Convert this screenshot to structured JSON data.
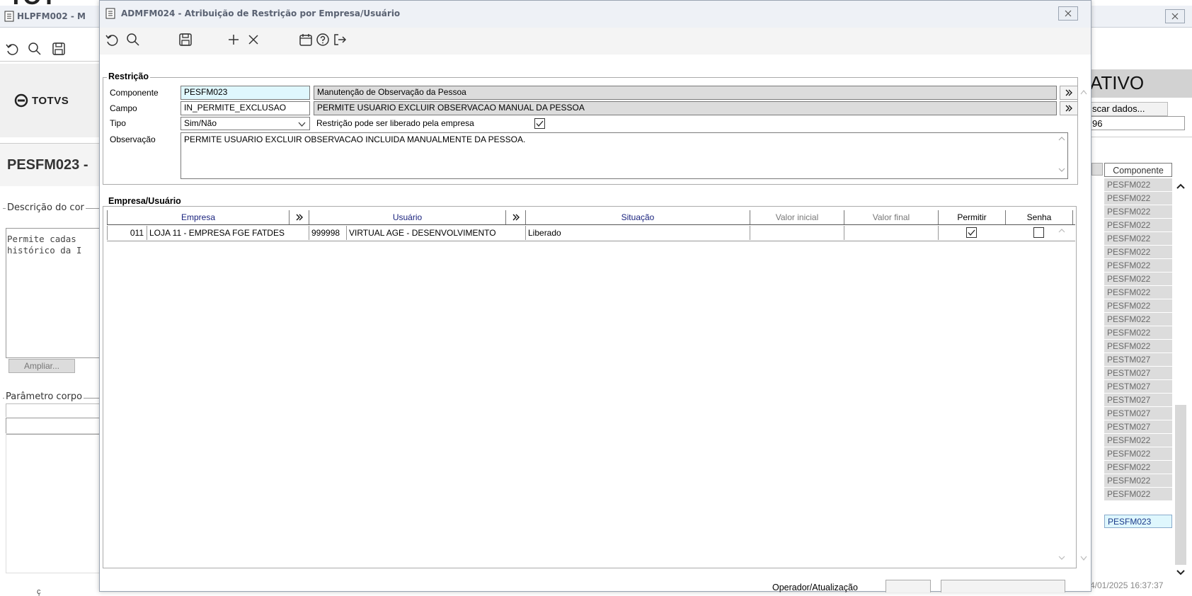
{
  "background_window": {
    "title": "HLPFM002 - M",
    "logo_partial": "TOT",
    "totvs_logo": "TOTVS",
    "heading": "PESFM023 -",
    "description_legend": "Descrição do cor",
    "description_text_line1": "Permite cadas",
    "description_text_line2": "histórico da I",
    "ampliar_button": "Ampliar...",
    "parametro_legend": "Parâmetro corpo",
    "status_label": "ATIVO",
    "buscar_button": "scar dados...",
    "code_value": "96",
    "grid_header": "Componente",
    "grid_rows": [
      "PESFM022",
      "PESFM022",
      "PESFM022",
      "PESFM022",
      "PESFM022",
      "PESFM022",
      "PESFM022",
      "PESFM022",
      "PESFM022",
      "PESFM022",
      "PESFM022",
      "PESFM022",
      "PESFM022",
      "PESTM027",
      "PESTM027",
      "PESTM027",
      "PESTM027",
      "PESTM027",
      "PESTM027",
      "PESFM022",
      "PESFM022",
      "PESFM022",
      "PESFM022",
      "PESFM022"
    ],
    "grid_selected": "PESFM023",
    "timestamp": "4/01/2025 16:37:37"
  },
  "dialog": {
    "title": "ADMFM024 - Atribuição de Restrição por Empresa/Usuário",
    "restricao": {
      "legend": "Restrição",
      "componente_label": "Componente",
      "componente_value": "PESFM023",
      "componente_desc": "Manutenção de Observação da Pessoa",
      "campo_label": "Campo",
      "campo_value": "IN_PERMITE_EXCLUSAO",
      "campo_desc": "PERMITE USUARIO EXCLUIR OBSERVACAO MANUAL DA PESSOA",
      "tipo_label": "Tipo",
      "tipo_value": "Sim/Não",
      "liberado_label": "Restrição pode ser liberado pela empresa",
      "liberado_checked": true,
      "observacao_label": "Observação",
      "observacao_value": "PERMITE USUARIO EXCLUIR OBSERVACAO INCLUIDA MANUALMENTE DA PESSOA."
    },
    "empresa_usuario": {
      "legend": "Empresa/Usuário",
      "columns": [
        "Empresa",
        "Usuário",
        "Situação",
        "Valor inicial",
        "Valor final",
        "Permitir",
        "Senha"
      ],
      "rows": [
        {
          "empresa_cod": "011",
          "empresa_nome": "LOJA 11 - EMPRESA FGE FATDES",
          "usuario_cod": "999998",
          "usuario_nome": "VIRTUAL AGE - DESENVOLVIMENTO",
          "situacao": "Liberado",
          "valor_inicial": "",
          "valor_final": "",
          "permitir": true,
          "senha": false
        }
      ]
    },
    "footer": {
      "operador_label": "Operador/Atualização"
    }
  },
  "colors": {
    "accent_field": "#dff7fd",
    "header_text": "#1a237e",
    "readonly": "#dcdcdc"
  }
}
